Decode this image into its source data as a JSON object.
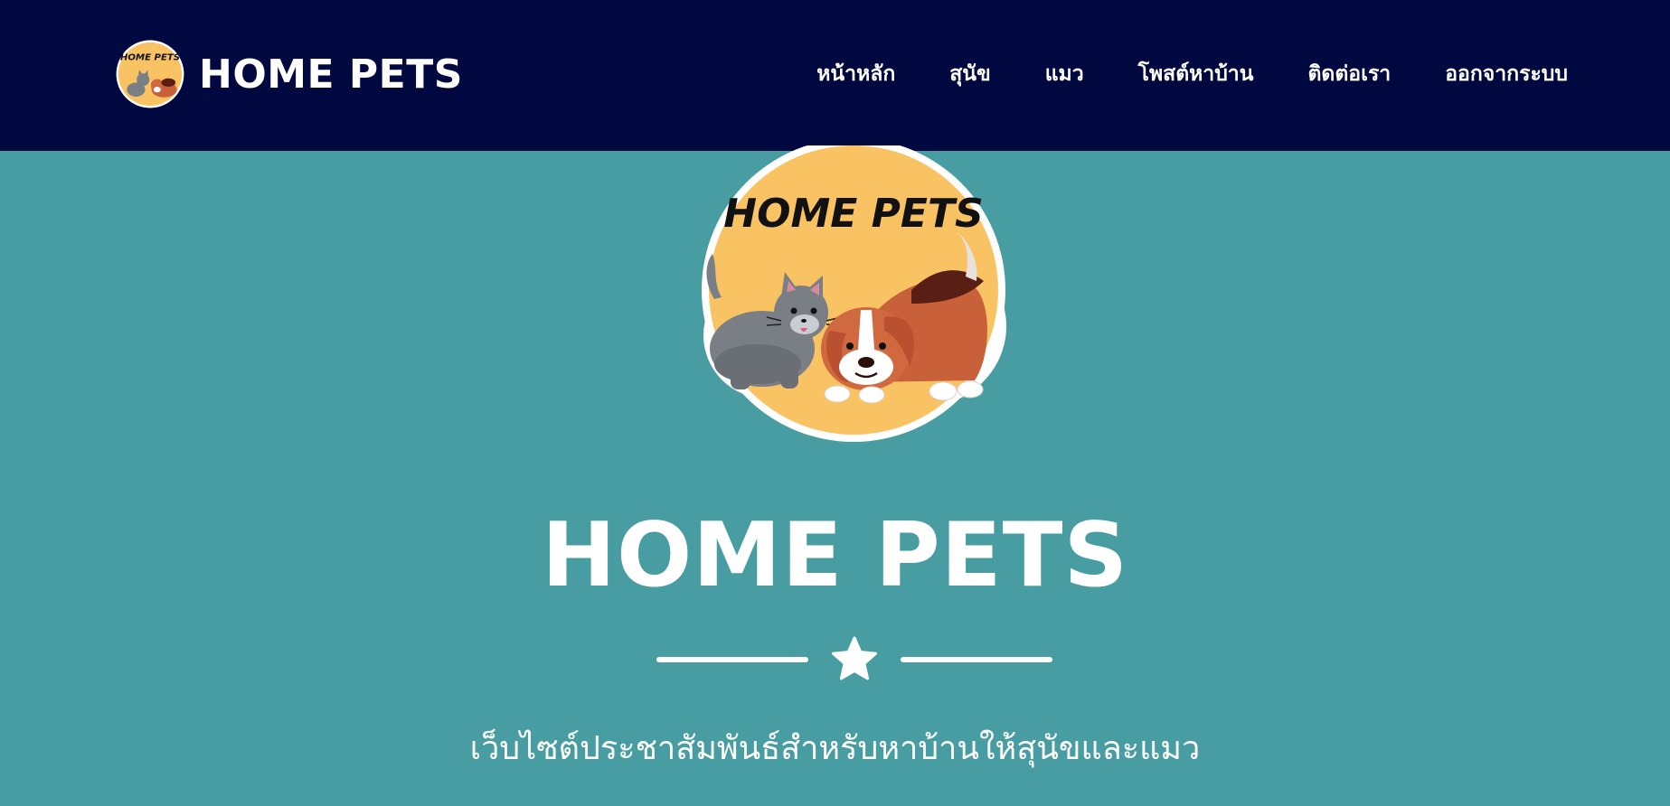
{
  "header": {
    "brand_name": "HOME PETS",
    "logo_label": "HOME PETS"
  },
  "nav": {
    "items": [
      {
        "label": "หน้าหลัก"
      },
      {
        "label": "สุนัข"
      },
      {
        "label": "แมว"
      },
      {
        "label": "โพสต์หาบ้าน"
      },
      {
        "label": "ติดต่อเรา"
      },
      {
        "label": "ออกจากระบบ"
      }
    ]
  },
  "hero": {
    "logo_label": "HOME PETS",
    "title": "HOME PETS",
    "divider_icon": "star-icon",
    "subtitle": "เว็บไซต์ประชาสัมพันธ์สำหรับหาบ้านให้สุนัขและแมว"
  },
  "colors": {
    "navbar_bg": "#000840",
    "hero_bg": "#489da3",
    "logo_circle": "#f9c364",
    "text": "#ffffff"
  }
}
